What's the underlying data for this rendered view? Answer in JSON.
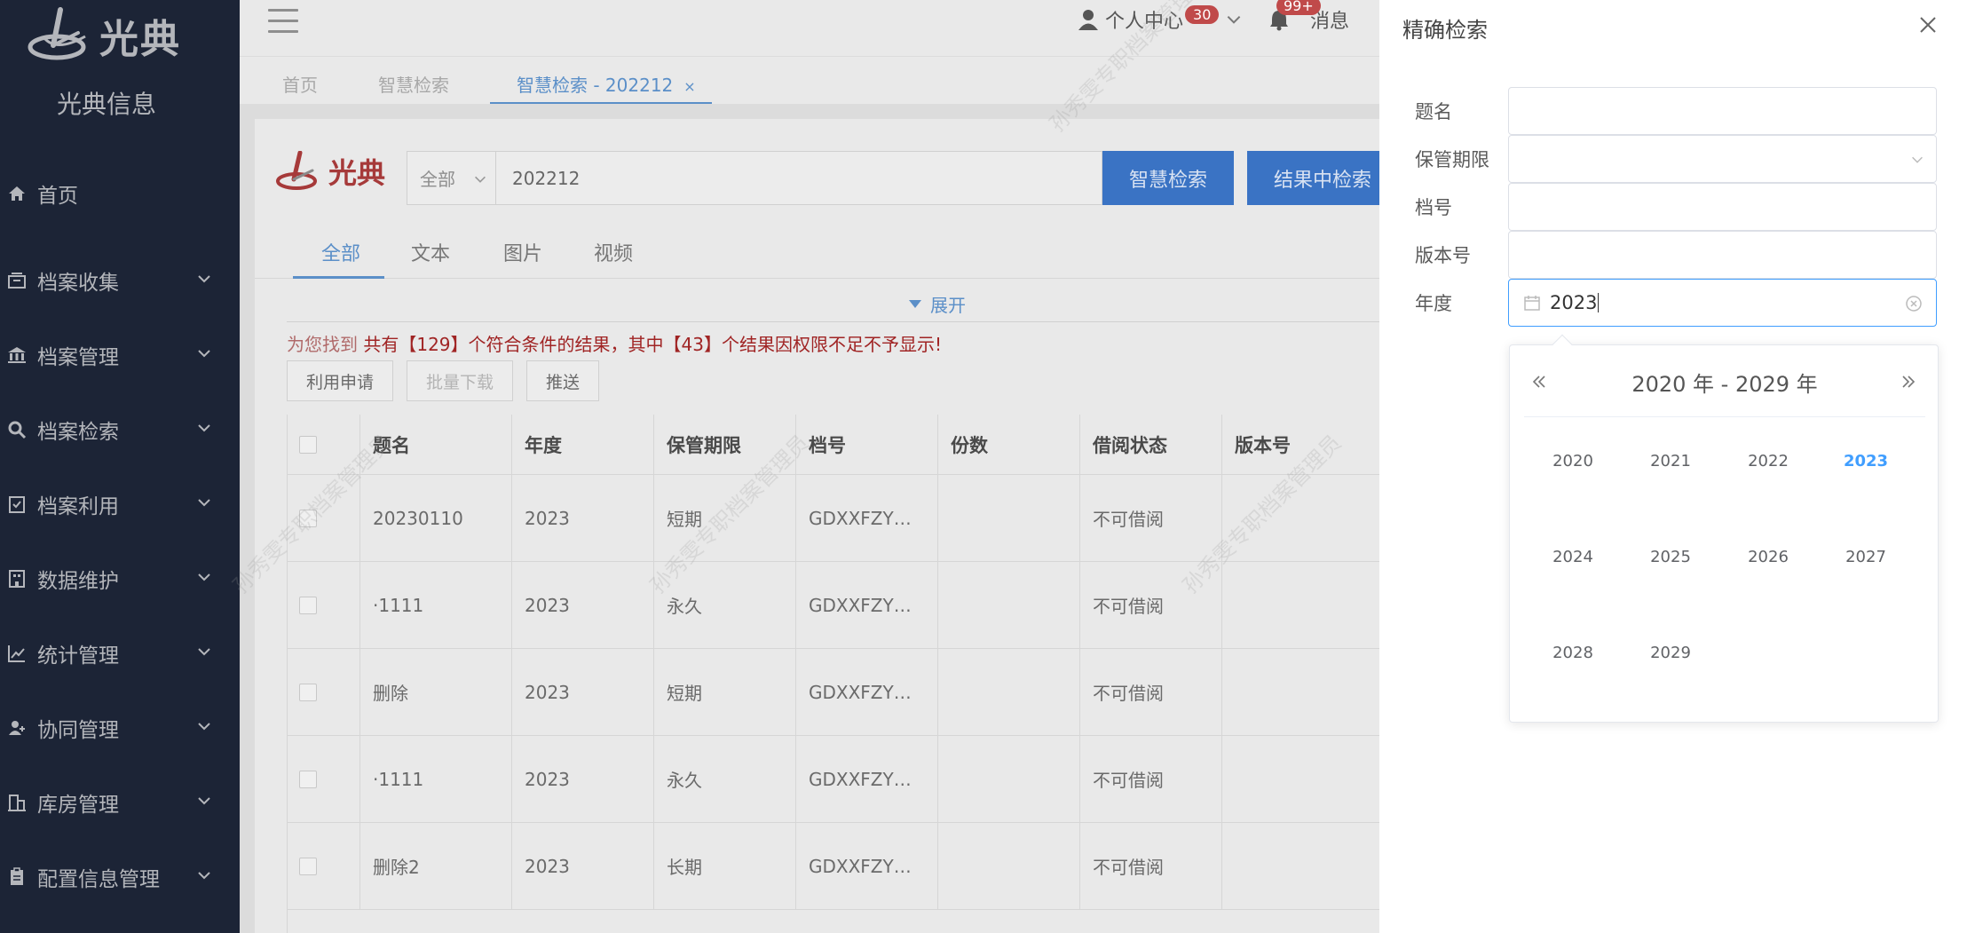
{
  "sidebar": {
    "logo_text": "光典",
    "brand_name": "光典信息",
    "items": [
      {
        "label": "首页",
        "icon": "home-icon",
        "has_children": false
      },
      {
        "label": "档案收集",
        "icon": "inbox-icon",
        "has_children": true
      },
      {
        "label": "档案管理",
        "icon": "bank-icon",
        "has_children": true
      },
      {
        "label": "档案检索",
        "icon": "search-icon",
        "has_children": true
      },
      {
        "label": "档案利用",
        "icon": "clipboard-check-icon",
        "has_children": true
      },
      {
        "label": "数据维护",
        "icon": "building-icon",
        "has_children": true
      },
      {
        "label": "统计管理",
        "icon": "line-chart-icon",
        "has_children": true
      },
      {
        "label": "协同管理",
        "icon": "user-group-icon",
        "has_children": true
      },
      {
        "label": "库房管理",
        "icon": "warehouse-icon",
        "has_children": true
      },
      {
        "label": "配置信息管理",
        "icon": "clipboard-icon",
        "has_children": true
      }
    ]
  },
  "header": {
    "user_label": "个人中心",
    "user_badge": "30",
    "msg_label": "消息",
    "msg_badge": "99+"
  },
  "tabs": [
    {
      "label": "首页",
      "active": false
    },
    {
      "label": "智慧检索",
      "active": false
    },
    {
      "label": "智慧检索 - 202212",
      "active": true,
      "close": "×"
    }
  ],
  "search": {
    "logo_text": "光典",
    "scope": "全部",
    "query": "202212",
    "smart_button": "智慧检索",
    "result_button": "结果中检索"
  },
  "type_tabs": [
    "全部",
    "文本",
    "图片",
    "视频"
  ],
  "expand_label": "展开",
  "result_message": {
    "prefix": "为您找到 ",
    "main": "共有【129】个符合条件的结果，其中【43】个结果因权限不足不予显示!"
  },
  "actions": {
    "apply": "利用申请",
    "batch_download": "批量下载",
    "push": "推送"
  },
  "table": {
    "columns": [
      "题名",
      "年度",
      "保管期限",
      "档号",
      "份数",
      "借阅状态",
      "版本号"
    ],
    "rows": [
      [
        "20230110",
        "2023",
        "短期",
        "GDXXFZY…",
        "",
        "不可借阅",
        ""
      ],
      [
        "·1111",
        "2023",
        "永久",
        "GDXXFZY…",
        "",
        "不可借阅",
        ""
      ],
      [
        "删除",
        "2023",
        "短期",
        "GDXXFZY…",
        "",
        "不可借阅",
        ""
      ],
      [
        "·1111",
        "2023",
        "永久",
        "GDXXFZY…",
        "",
        "不可借阅",
        ""
      ],
      [
        "删除2",
        "2023",
        "长期",
        "GDXXFZY…",
        "",
        "不可借阅",
        ""
      ]
    ]
  },
  "watermark_text": "孙秀雯专职档案管理员",
  "drawer": {
    "title": "精确检索",
    "fields": [
      {
        "label": "题名",
        "value": "",
        "type": "text"
      },
      {
        "label": "保管期限",
        "value": "",
        "type": "select"
      },
      {
        "label": "档号",
        "value": "",
        "type": "text"
      },
      {
        "label": "版本号",
        "value": "",
        "type": "text"
      },
      {
        "label": "年度",
        "value": "2023",
        "type": "year"
      }
    ]
  },
  "year_picker": {
    "header": "2020 年 - 2029 年",
    "years": [
      "2020",
      "2021",
      "2022",
      "2023",
      "2024",
      "2025",
      "2026",
      "2027",
      "2028",
      "2029"
    ],
    "selected": "2023"
  },
  "colors": {
    "sidebar_bg": "#1c2436",
    "accent": "#409eff",
    "primary_button": "#3a73c4",
    "warning_text": "#a02424"
  }
}
